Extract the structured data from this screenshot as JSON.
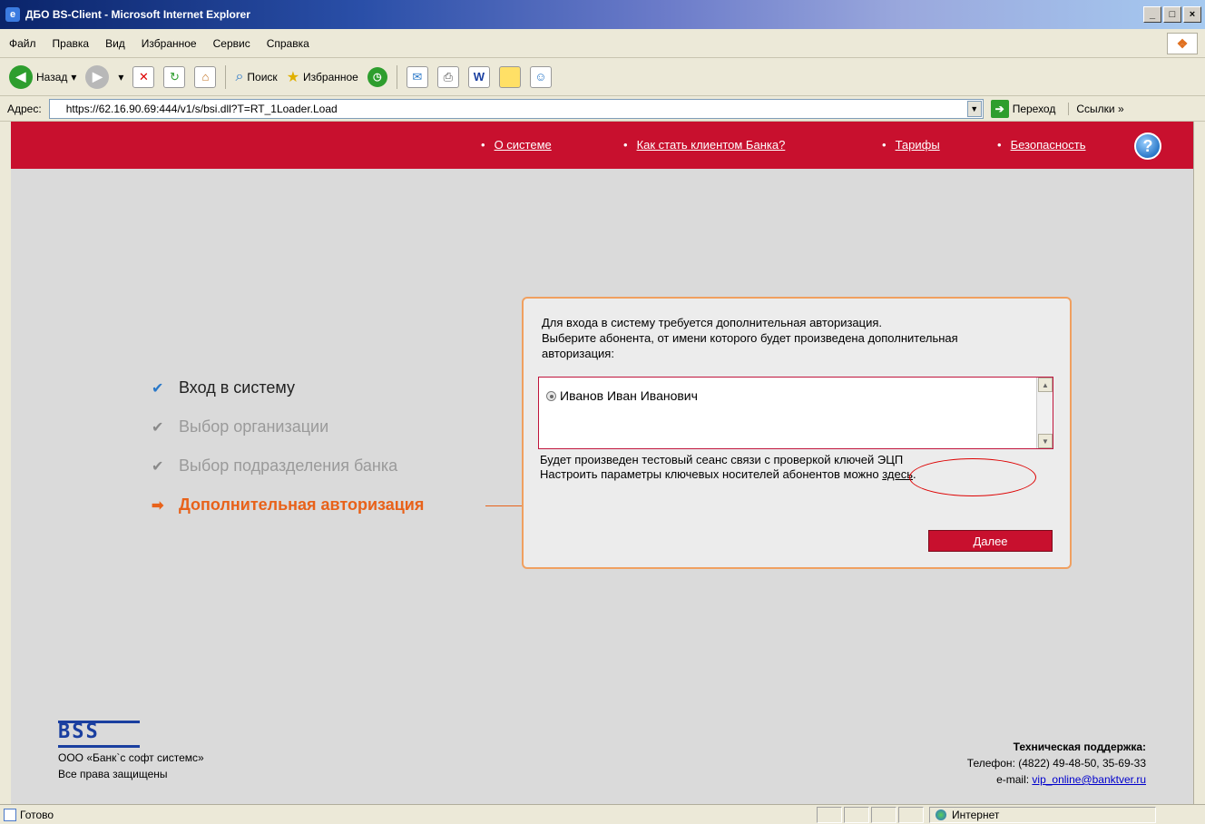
{
  "window": {
    "title": "ДБО BS-Client - Microsoft Internet Explorer",
    "btn_min": "_",
    "btn_max": "□",
    "btn_close": "×"
  },
  "menubar": [
    "Файл",
    "Правка",
    "Вид",
    "Избранное",
    "Сервис",
    "Справка"
  ],
  "toolbar": {
    "back": "Назад",
    "search": "Поиск",
    "favorites": "Избранное"
  },
  "addressbar": {
    "label": "Адрес:",
    "url": "https://62.16.90.69:444/v1/s/bsi.dll?T=RT_1Loader.Load",
    "go": "Переход",
    "links": "Ссылки »"
  },
  "nav": {
    "about": "О системе",
    "become_client": "Как стать клиентом Банка?",
    "tariffs": "Тарифы",
    "security": "Безопасность"
  },
  "steps": {
    "s1": "Вход в систему",
    "s2": "Выбор организации",
    "s3": "Выбор подразделения банка",
    "s4": "Дополнительная авторизация"
  },
  "panel": {
    "line1": "Для входа в систему требуется дополнительная авторизация.",
    "line2": "Выберите абонента, от имени которого будет произведена дополнительная",
    "line3": "авторизация:",
    "subscriber": "Иванов Иван Иванович",
    "note1": "Будет произведен тестовый сеанс связи с проверкой ключей ЭЦП",
    "note2_prefix": "Настроить параметры ключевых носителей абонентов можно ",
    "note2_link": "здесь",
    "note2_suffix": ".",
    "next": "Далее"
  },
  "footer": {
    "logo": "BSS",
    "company": "ООО «Банк`с софт системс»",
    "rights": "Все права защищены",
    "support_title": "Техническая поддержка:",
    "phone": "Телефон: (4822) 49-48-50, 35-69-33",
    "email_prefix": "e-mail: ",
    "email": "vip_online@banktver.ru"
  },
  "status": {
    "ready": "Готово",
    "zone": "Интернет"
  }
}
